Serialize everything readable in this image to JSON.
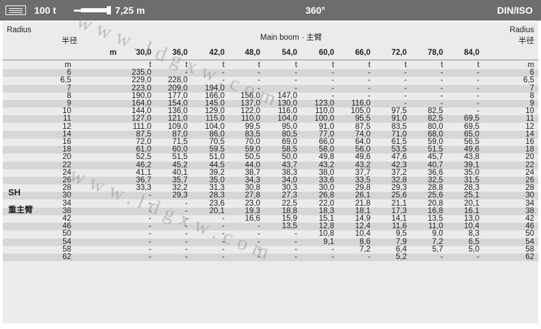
{
  "topbar": {
    "weight": "100 t",
    "length": "7,25 m",
    "slewing": "360°",
    "standard": "DIN/ISO",
    "icons": [
      "menu-icon",
      "boom-icon"
    ]
  },
  "table": {
    "radius_left": "Radius",
    "radius_left_cn": "半径",
    "radius_right": "Radius",
    "radius_right_cn": "半径",
    "boom_title": "Main boom · 主臂",
    "unit_m": "m",
    "unit_t": "t",
    "config_en": "SH",
    "config_cn": "重主臂",
    "boom_lengths": [
      "30,0",
      "36,0",
      "42,0",
      "48,0",
      "54,0",
      "60,0",
      "66,0",
      "72,0",
      "78,0",
      "84,0"
    ],
    "rows": [
      {
        "r": "6",
        "v": [
          "235,0",
          "-",
          "-",
          "-",
          "-",
          "-",
          "-",
          "-",
          "-",
          "-"
        ],
        "rr": "6"
      },
      {
        "r": "6,5",
        "v": [
          "229,0",
          "228,0",
          "-",
          "-",
          "-",
          "-",
          "-",
          "-",
          "-",
          "-"
        ],
        "rr": "6,5"
      },
      {
        "r": "7",
        "v": [
          "223,0",
          "209,0",
          "194,0",
          "-",
          "-",
          "-",
          "-",
          "-",
          "-",
          "-"
        ],
        "rr": "7"
      },
      {
        "r": "8",
        "v": [
          "190,0",
          "177,0",
          "166,0",
          "156,0",
          "147,0",
          "-",
          "-",
          "-",
          "-",
          "-"
        ],
        "rr": "8"
      },
      {
        "r": "9",
        "v": [
          "164,0",
          "154,0",
          "145,0",
          "137,0",
          "130,0",
          "123,0",
          "116,0",
          "-",
          "-",
          "-"
        ],
        "rr": "9"
      },
      {
        "r": "10",
        "v": [
          "144,0",
          "136,0",
          "129,0",
          "122,0",
          "116,0",
          "110,0",
          "105,0",
          "97,5",
          "82,5",
          "-"
        ],
        "rr": "10"
      },
      {
        "r": "11",
        "v": [
          "127,0",
          "121,0",
          "115,0",
          "110,0",
          "104,0",
          "100,0",
          "95,5",
          "91,0",
          "82,5",
          "69,5"
        ],
        "rr": "11"
      },
      {
        "r": "12",
        "v": [
          "111,0",
          "109,0",
          "104,0",
          "99,5",
          "95,0",
          "91,0",
          "87,5",
          "83,5",
          "80,0",
          "69,5"
        ],
        "rr": "12"
      },
      {
        "r": "14",
        "v": [
          "87,5",
          "87,0",
          "86,0",
          "83,5",
          "80,5",
          "77,0",
          "74,0",
          "71,0",
          "68,0",
          "65,0"
        ],
        "rr": "14"
      },
      {
        "r": "16",
        "v": [
          "72,0",
          "71,5",
          "70,5",
          "70,0",
          "69,0",
          "66,0",
          "64,0",
          "61,5",
          "59,0",
          "56,5"
        ],
        "rr": "16"
      },
      {
        "r": "18",
        "v": [
          "61,0",
          "60,0",
          "59,5",
          "59,0",
          "58,5",
          "58,0",
          "56,0",
          "53,5",
          "51,5",
          "49,6"
        ],
        "rr": "18"
      },
      {
        "r": "20",
        "v": [
          "52,5",
          "51,5",
          "51,0",
          "50,5",
          "50,0",
          "49,8",
          "49,6",
          "47,6",
          "45,7",
          "43,8"
        ],
        "rr": "20"
      },
      {
        "r": "22",
        "v": [
          "46,2",
          "45,2",
          "44,5",
          "44,0",
          "43,7",
          "43,2",
          "43,2",
          "42,3",
          "40,7",
          "39,1"
        ],
        "rr": "22"
      },
      {
        "r": "24",
        "v": [
          "41,1",
          "40,1",
          "39,2",
          "38,7",
          "38,3",
          "38,0",
          "37,7",
          "37,2",
          "36,6",
          "35,0"
        ],
        "rr": "24"
      },
      {
        "r": "26",
        "v": [
          "36,7",
          "35,7",
          "35,0",
          "34,3",
          "34,0",
          "33,6",
          "33,5",
          "32,8",
          "32,5",
          "31,5"
        ],
        "rr": "26"
      },
      {
        "r": "28",
        "v": [
          "33,3",
          "32,2",
          "31,3",
          "30,8",
          "30,3",
          "30,0",
          "29,8",
          "29,3",
          "28,8",
          "28,3"
        ],
        "rr": "28"
      },
      {
        "r": "30",
        "v": [
          "-",
          "29,3",
          "28,3",
          "27,8",
          "27,3",
          "26,8",
          "26,1",
          "25,6",
          "25,6",
          "25,1"
        ],
        "rr": "30"
      },
      {
        "r": "34",
        "v": [
          "-",
          "-",
          "23,6",
          "23,0",
          "22,5",
          "22,0",
          "21,8",
          "21,1",
          "20,8",
          "20,1"
        ],
        "rr": "34"
      },
      {
        "r": "38",
        "v": [
          "-",
          "-",
          "20,1",
          "19,3",
          "18,8",
          "18,3",
          "18,1",
          "17,3",
          "16,8",
          "16,1"
        ],
        "rr": "38"
      },
      {
        "r": "42",
        "v": [
          "-",
          "-",
          "-",
          "16,6",
          "15,9",
          "15,1",
          "14,9",
          "14,1",
          "13,5",
          "13,0"
        ],
        "rr": "42"
      },
      {
        "r": "46",
        "v": [
          "-",
          "-",
          "-",
          "-",
          "13,5",
          "12,8",
          "12,4",
          "11,6",
          "11,0",
          "10,4"
        ],
        "rr": "46"
      },
      {
        "r": "50",
        "v": [
          "-",
          "-",
          "-",
          "-",
          "-",
          "10,8",
          "10,4",
          "9,5",
          "9,0",
          "8,3"
        ],
        "rr": "50"
      },
      {
        "r": "54",
        "v": [
          "-",
          "-",
          "-",
          "-",
          "-",
          "9,1",
          "8,6",
          "7,9",
          "7,2",
          "6,5"
        ],
        "rr": "54"
      },
      {
        "r": "58",
        "v": [
          "-",
          "-",
          "-",
          "-",
          "-",
          "-",
          "7,2",
          "6,4",
          "5,7",
          "5,0"
        ],
        "rr": "58"
      },
      {
        "r": "62",
        "v": [
          "-",
          "-",
          "-",
          "-",
          "-",
          "-",
          "-",
          "5,2",
          "-",
          "-"
        ],
        "rr": "62"
      }
    ]
  },
  "watermark": {
    "text_top": "www.ldgxw.com",
    "text_bottom": "www.ldgxw.com",
    "color": "#8a8a8a"
  },
  "colors": {
    "topbar": "#6d6d6d",
    "panel": "#ebebeb",
    "row_shade": "#d6d6d6"
  }
}
